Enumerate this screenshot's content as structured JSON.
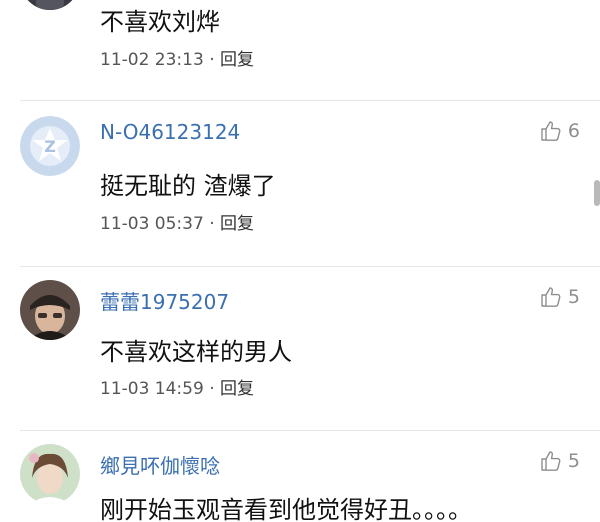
{
  "comments": [
    {
      "username": "",
      "text": "不喜欢刘烨",
      "timestamp": "11-02 23:13",
      "reply_label": "回复",
      "likes": "",
      "avatar": "top-cropped-avatar"
    },
    {
      "username": "N-O46123124",
      "text": "挺无耻的 渣爆了",
      "timestamp": "11-03 05:37",
      "reply_label": "回复",
      "likes": "6",
      "avatar": "default-z-avatar"
    },
    {
      "username": "蕾蕾1975207",
      "text": "不喜欢这样的男人",
      "timestamp": "11-03 14:59",
      "reply_label": "回复",
      "likes": "5",
      "avatar": "photo-avatar-man-with-cap"
    },
    {
      "username": "鄉見吥伽懷唸",
      "text": "刚开始玉观音看到他觉得好丑。。。。",
      "timestamp": "",
      "reply_label": "",
      "likes": "5",
      "avatar": "photo-avatar-girl"
    }
  ],
  "colors": {
    "username": "#3b6fb1",
    "like_icon": "#8e8e8e",
    "meta": "#555555"
  },
  "icons": {
    "like": "thumbs-up-outline-icon"
  }
}
